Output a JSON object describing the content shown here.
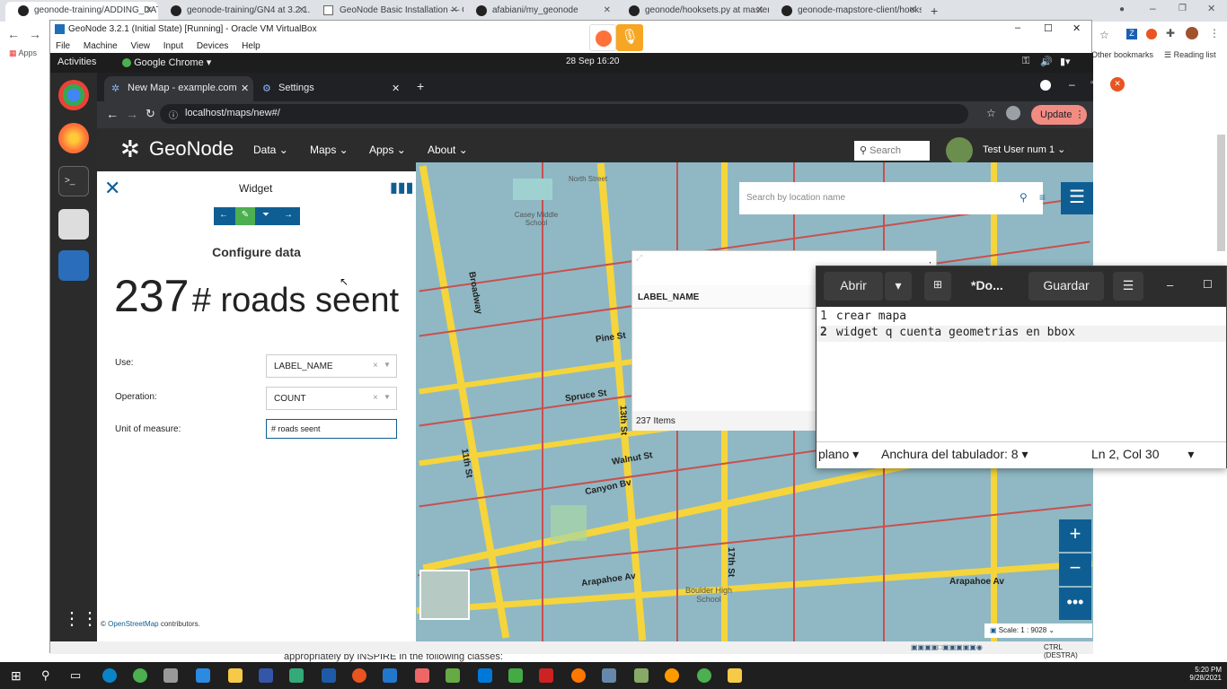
{
  "host_tabs": [
    {
      "title": "geonode-training/ADDING_DATA..."
    },
    {
      "title": "geonode-training/GN4 at 3.2.1..."
    },
    {
      "title": "GeoNode Basic Installation — Ge..."
    },
    {
      "title": "afabiani/my_geonode"
    },
    {
      "title": "geonode/hooksets.py at master..."
    },
    {
      "title": "geonode-mapstore-client/hooks..."
    }
  ],
  "host_toolbar": {
    "apps_label": "Apps",
    "other_bookmarks": "Other bookmarks",
    "reading_list": "Reading list"
  },
  "vbox": {
    "title": "GeoNode 3.2.1 (Initial State) [Running] - Oracle VM VirtualBox",
    "menu": [
      "File",
      "Machine",
      "View",
      "Input",
      "Devices",
      "Help"
    ],
    "status_key": "CTRL (DESTRA)"
  },
  "gnome": {
    "activities": "Activities",
    "app_name": "Google Chrome",
    "clock": "28 Sep  16:20"
  },
  "chrome": {
    "tabs": [
      {
        "title": "New Map - example.com"
      },
      {
        "title": "Settings"
      }
    ],
    "url": "localhost/maps/new#/",
    "update_label": "Update"
  },
  "geonode": {
    "logo_text": "GeoNode",
    "menus": [
      "Data",
      "Maps",
      "Apps",
      "About"
    ],
    "search_placeholder": "Search",
    "user_name": "Test User num 1"
  },
  "widget": {
    "title": "Widget",
    "section_title": "Configure data",
    "counter_value": "237",
    "counter_unit": "# roads seent",
    "fields": [
      {
        "label": "Use:",
        "value": "LABEL_NAME"
      },
      {
        "label": "Operation:",
        "value": "COUNT"
      }
    ],
    "unit_label": "Unit of measure:",
    "unit_value": "# roads seent"
  },
  "map": {
    "search_placeholder": "Search by location name",
    "table_header": "LABEL_NAME",
    "items_count": "237 Items",
    "scale_label": "Scale:",
    "scale_value": "1 : 9028",
    "street_labels": [
      "Pine St",
      "Spruce St",
      "Walnut St",
      "Canyon Bv",
      "Arapahoe Av",
      "Broadway",
      "13th St",
      "11th St",
      "17th St",
      "Boulder High School",
      "North Street",
      "Casey Middle School",
      "Arapahoe Av"
    ]
  },
  "osm_attribution": {
    "prefix": "©",
    "link": "OpenStreetMap",
    "suffix": "contributors."
  },
  "gedit": {
    "open_label": "Abrir",
    "doc_title": "*Do...",
    "save_label": "Guardar",
    "lines": [
      {
        "num": "1",
        "text": "crear mapa"
      },
      {
        "num": "2",
        "text": "widget q cuenta geometrias en bbox"
      }
    ],
    "status_mode": "plano",
    "status_tab": "Anchura del tabulador: 8",
    "status_pos": "Ln 2, Col 30"
  },
  "background_text": "appropriately by INSPIRE in the following classes:",
  "taskbar": {
    "time": "5:20 PM",
    "date": "9/28/2021"
  }
}
